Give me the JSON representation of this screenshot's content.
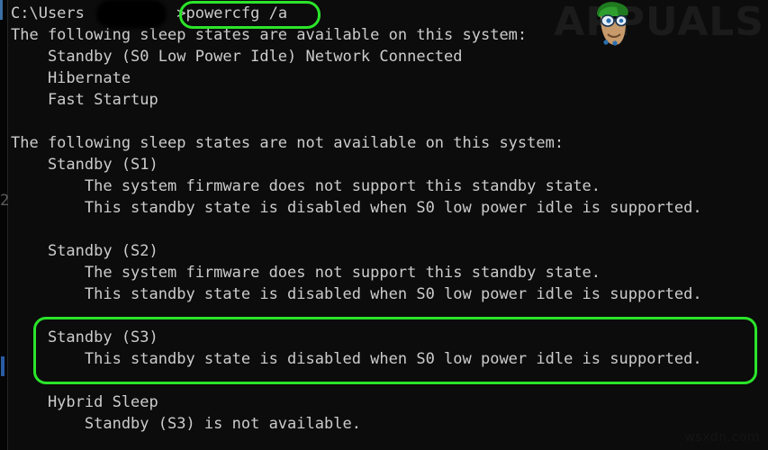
{
  "window": {
    "background_color": "#0c0c0c",
    "text_color": "#cccccc",
    "accent_color": "#2ae52a",
    "edge_marker": "2"
  },
  "prompt": {
    "path": "C:\\Users",
    "redacted_user_label": "",
    "separator": ">",
    "command": "powercfg /a"
  },
  "output": {
    "lines": [
      {
        "id": "available-header",
        "text": "The following sleep states are available on this system:",
        "indent": 0
      },
      {
        "id": "available-s0",
        "text": "Standby (S0 Low Power Idle) Network Connected",
        "indent": 1
      },
      {
        "id": "available-hibernate",
        "text": "Hibernate",
        "indent": 1
      },
      {
        "id": "available-fast-startup",
        "text": "Fast Startup",
        "indent": 1
      },
      {
        "id": "spacer-1",
        "text": "",
        "indent": 0
      },
      {
        "id": "unavailable-header",
        "text": "The following sleep states are not available on this system:",
        "indent": 0
      },
      {
        "id": "s1-title",
        "text": "Standby (S1)",
        "indent": 1
      },
      {
        "id": "s1-reason-1",
        "text": "The system firmware does not support this standby state.",
        "indent": 2
      },
      {
        "id": "s1-reason-2",
        "text": "This standby state is disabled when S0 low power idle is supported.",
        "indent": 2
      },
      {
        "id": "spacer-2",
        "text": "",
        "indent": 0
      },
      {
        "id": "s2-title",
        "text": "Standby (S2)",
        "indent": 1
      },
      {
        "id": "s2-reason-1",
        "text": "The system firmware does not support this standby state.",
        "indent": 2
      },
      {
        "id": "s2-reason-2",
        "text": "This standby state is disabled when S0 low power idle is supported.",
        "indent": 2
      },
      {
        "id": "spacer-3",
        "text": "",
        "indent": 0
      },
      {
        "id": "s3-title",
        "text": "Standby (S3)",
        "indent": 1
      },
      {
        "id": "s3-reason-1",
        "text": "This standby state is disabled when S0 low power idle is supported.",
        "indent": 2
      },
      {
        "id": "spacer-4",
        "text": "",
        "indent": 0
      },
      {
        "id": "hybrid-title",
        "text": "Hybrid Sleep",
        "indent": 1
      },
      {
        "id": "hybrid-reason-1",
        "text": "Standby (S3) is not available.",
        "indent": 2
      }
    ]
  },
  "annotations": {
    "command_highlight": {
      "target": "powercfg /a",
      "color": "#2ae52a"
    },
    "s3_highlight": {
      "target": "Standby (S3) block",
      "color": "#2ae52a"
    }
  },
  "watermarks": {
    "brand": "APPUALS",
    "brand_prefix": "A",
    "brand_suffix": "PUALS",
    "site": "wsxdn.com"
  }
}
